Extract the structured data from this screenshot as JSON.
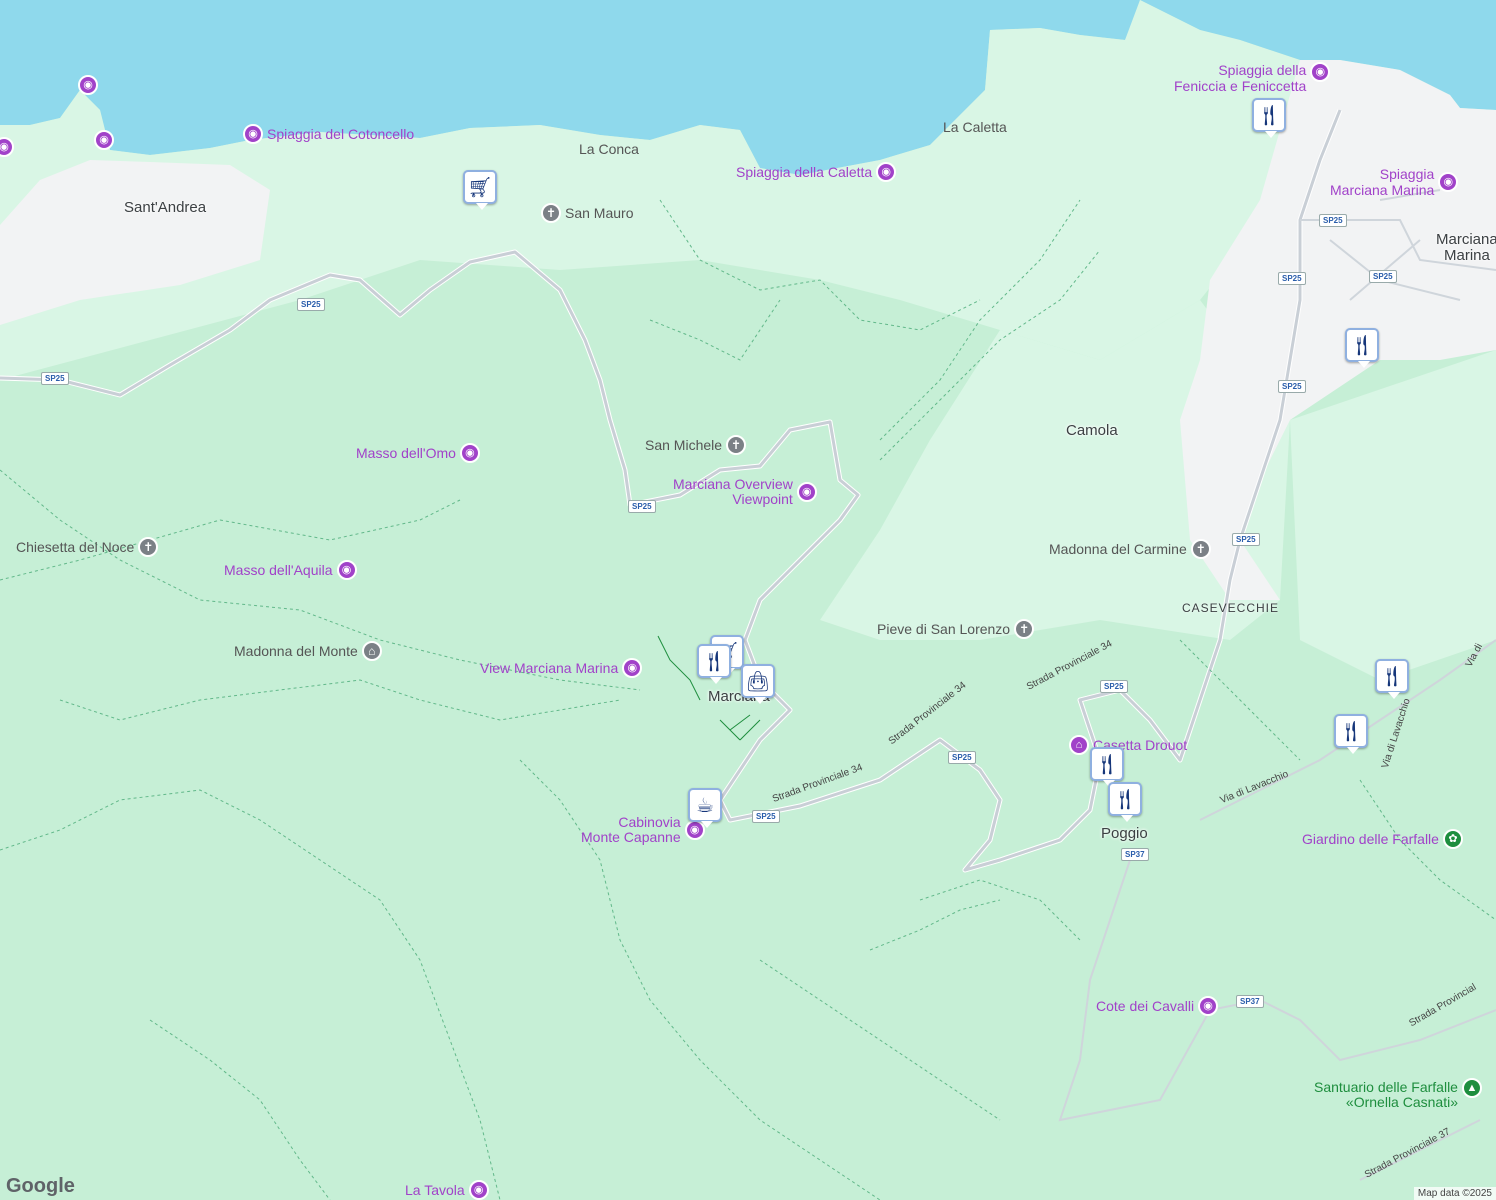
{
  "map": {
    "colors": {
      "sea": "#8fd9ec",
      "land": "#c6efd6",
      "light_land": "#d9f6e5",
      "town": "#f2f3f4",
      "road": "#cfd3d8"
    },
    "places": {
      "sant_andrea": "Sant'Andrea",
      "camola": "Camola",
      "casevecchie": "CASEVECCHIE",
      "poggio": "Poggio",
      "marciana": "Marciana",
      "marciana_marina_1": "Marciana",
      "marciana_marina_2": "Marina"
    },
    "gray_labels": {
      "la_conca": "La Conca",
      "la_caletta": "La Caletta",
      "san_mauro": "San Mauro",
      "san_michele": "San Michele",
      "chiesetta": "Chiesetta del Noce",
      "madonna_monte": "Madonna del Monte",
      "madonna_carmine": "Madonna del Carmine",
      "pieve": "Pieve di San Lorenzo"
    },
    "pois": {
      "cotoncello": "Spiaggia del Cotoncello",
      "caletta": "Spiaggia della Caletta",
      "feniccia_1": "Spiaggia della",
      "feniccia_2": "Feniccia e Feniccetta",
      "sp_marciana_1": "Spiaggia",
      "sp_marciana_2": "Marciana Marina",
      "masso_omo": "Masso dell'Omo",
      "overview_1": "Marciana Overview",
      "overview_2": "Viewpoint",
      "masso_aquila": "Masso dell'Aquila",
      "view_marina": "View Marciana Marina",
      "casetta": "Casetta Drouot",
      "cabinovia_1": "Cabinovia",
      "cabinovia_2": "Monte Capanne",
      "giardino": "Giardino delle Farfalle",
      "cote": "Cote dei Cavalli",
      "santuario_1": "Santuario delle Farfalle",
      "santuario_2": "«Ornella Casnati»",
      "la_tavola": "La Tavola"
    },
    "roads": {
      "sp25": "SP25",
      "sp37": "SP37",
      "strada34": "Strada Provinciale 34",
      "strada37": "Strada Provinciale 37",
      "strada_prov": "Strada Provincial",
      "via_lavacchio": "Via di Lavacchio",
      "via_di": "Via di"
    },
    "icons": {
      "shopping": "shopping-cart-icon",
      "restaurant": "restaurant-icon",
      "cafe": "coffee-icon",
      "store": "shopping-bag-icon",
      "camera": "camera-icon",
      "church": "cross-icon"
    },
    "footer": {
      "logo": "Google",
      "attribution": "Map data ©2025"
    }
  }
}
